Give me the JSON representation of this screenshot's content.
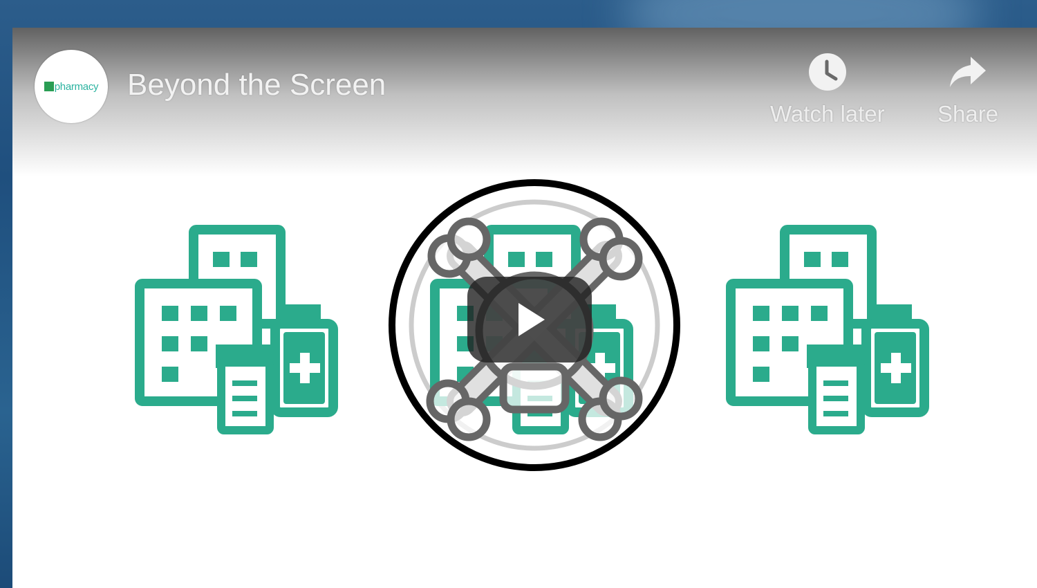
{
  "player": {
    "title": "Beyond the Screen",
    "channel": {
      "logo_text": "pharmacy",
      "logo_icon": "pharmacy-logo",
      "brand_color": "#2bb3a0"
    },
    "actions": {
      "watch_later": {
        "label": "Watch later",
        "icon": "clock-icon"
      },
      "share": {
        "label": "Share",
        "icon": "share-arrow-icon"
      }
    },
    "play_icon": "play-icon"
  },
  "thumbnail": {
    "illustrations": [
      {
        "name": "pharmacy-buildings-left",
        "icon": "pharmacy-building-icon"
      },
      {
        "name": "pharmacy-buildings-center",
        "icon": "pharmacy-building-icon",
        "overlay": "skull-crossbones-icon"
      },
      {
        "name": "pharmacy-buildings-right",
        "icon": "pharmacy-building-icon"
      }
    ],
    "colors": {
      "accent": "#2bab8c",
      "ring": "#000000",
      "skull": "#666666"
    }
  }
}
